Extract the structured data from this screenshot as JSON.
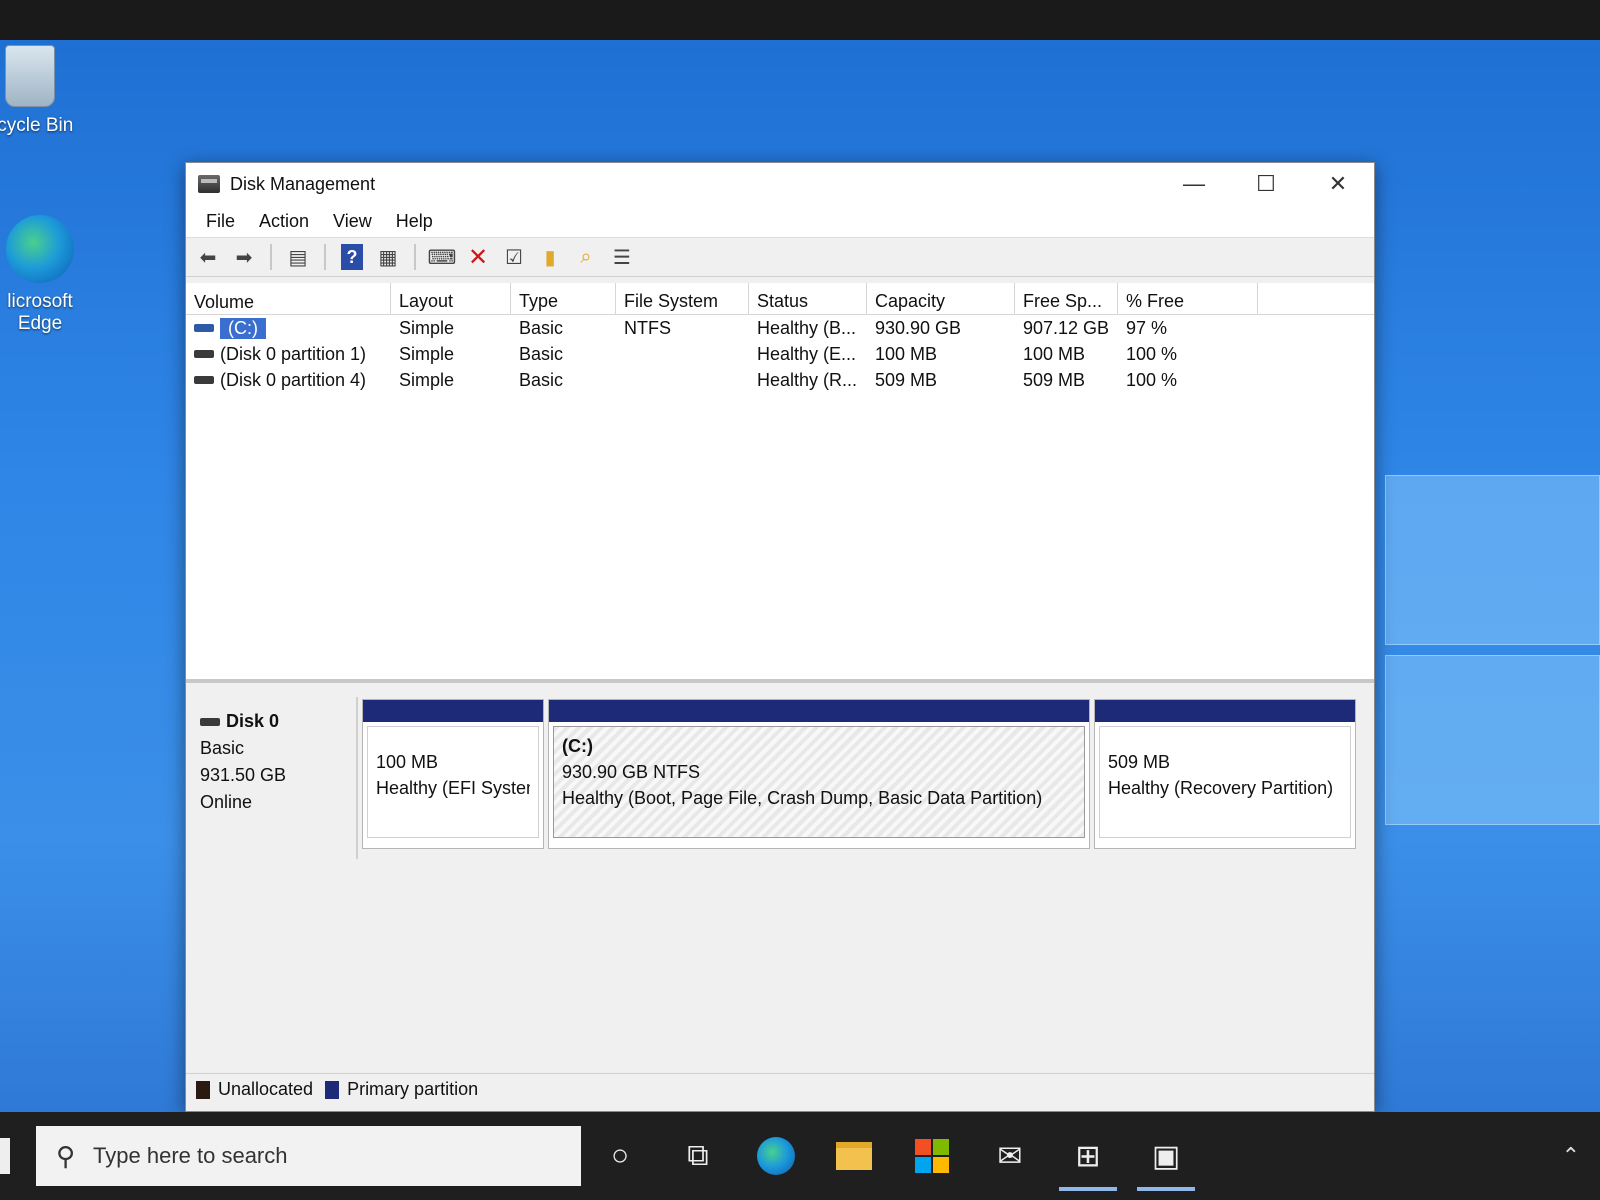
{
  "desktop": {
    "icons": [
      {
        "label": "ecycle Bin"
      },
      {
        "label": "licrosoft Edge"
      }
    ]
  },
  "window": {
    "title": "Disk Management",
    "controls": {
      "minimize": "—",
      "maximize": "☐",
      "close": "✕"
    }
  },
  "menu": [
    "File",
    "Action",
    "View",
    "Help"
  ],
  "volume_list": {
    "columns": [
      "Volume",
      "Layout",
      "Type",
      "File System",
      "Status",
      "Capacity",
      "Free Sp...",
      "% Free"
    ],
    "rows": [
      {
        "volume": "(C:)",
        "layout": "Simple",
        "type": "Basic",
        "fs": "NTFS",
        "status": "Healthy (B...",
        "capacity": "930.90 GB",
        "free": "907.12 GB",
        "pct": "97 %"
      },
      {
        "volume": "(Disk 0 partition 1)",
        "layout": "Simple",
        "type": "Basic",
        "fs": "",
        "status": "Healthy (E...",
        "capacity": "100 MB",
        "free": "100 MB",
        "pct": "100 %"
      },
      {
        "volume": "(Disk 0 partition 4)",
        "layout": "Simple",
        "type": "Basic",
        "fs": "",
        "status": "Healthy (R...",
        "capacity": "509 MB",
        "free": "509 MB",
        "pct": "100 %"
      }
    ]
  },
  "disk": {
    "name": "Disk 0",
    "type": "Basic",
    "size": "931.50 GB",
    "state": "Online",
    "partitions": [
      {
        "label": "",
        "size": "100 MB",
        "status": "Healthy (EFI System"
      },
      {
        "label": "(C:)",
        "size": "930.90 GB NTFS",
        "status": "Healthy (Boot, Page File, Crash Dump, Basic Data Partition)"
      },
      {
        "label": "",
        "size": "509 MB",
        "status": "Healthy (Recovery Partition)"
      }
    ]
  },
  "legend": {
    "unallocated": "Unallocated",
    "primary": "Primary partition"
  },
  "taskbar": {
    "search_placeholder": "Type here to search"
  }
}
